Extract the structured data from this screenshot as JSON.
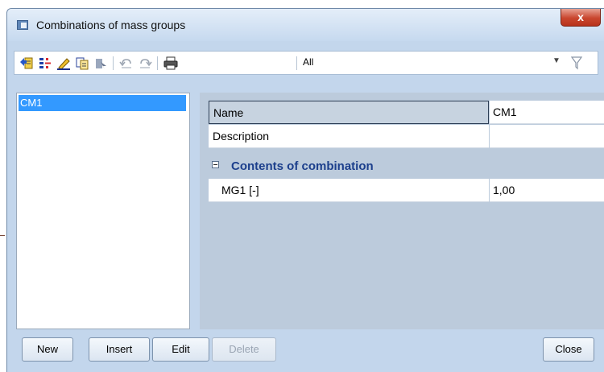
{
  "window": {
    "title": "Combinations of mass groups",
    "close_glyph": "x"
  },
  "toolbar": {
    "icons": [
      "new-record-icon",
      "insert-icon",
      "edit-pencil-icon",
      "copy-icon",
      "select-icon",
      "undo-icon",
      "redo-icon",
      "print-icon"
    ],
    "filter_value": "All",
    "dropdown_glyph": "▼"
  },
  "list": {
    "items": [
      {
        "label": "CM1",
        "selected": true
      }
    ]
  },
  "properties": {
    "name_label": "Name",
    "name_value": "CM1",
    "description_label": "Description",
    "description_value": "",
    "group_label": "Contents of combination",
    "items": [
      {
        "label": "MG1 [-]",
        "value": "1,00"
      }
    ]
  },
  "buttons": {
    "new": "New",
    "insert": "Insert",
    "edit": "Edit",
    "delete": "Delete",
    "close": "Close"
  },
  "colors": {
    "selection": "#3399ff",
    "group_text": "#1c3f8c",
    "window_bg": "#c3d6ec",
    "close_red": "#c9462e"
  }
}
